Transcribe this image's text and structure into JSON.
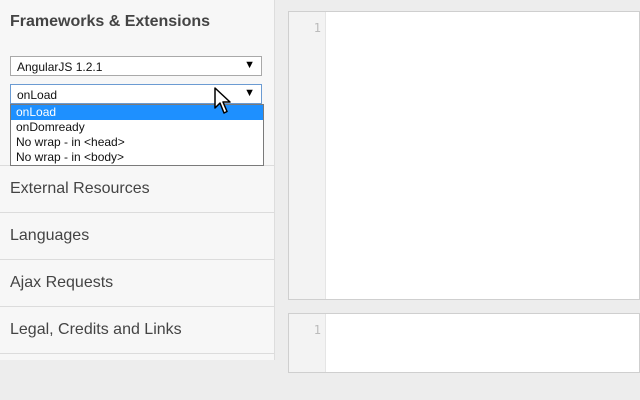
{
  "sidebar": {
    "title": "Frameworks & Extensions",
    "framework_select": {
      "value": "AngularJS 1.2.1"
    },
    "load_select": {
      "value": "onLoad",
      "options": [
        "onLoad",
        "onDomready",
        "No wrap - in <head>",
        "No wrap - in <body>"
      ],
      "selected_index": 0
    },
    "panels": [
      "",
      "External Resources",
      "Languages",
      "Ajax Requests",
      "Legal, Credits and Links"
    ]
  },
  "editors": [
    {
      "line_number": "1"
    },
    {
      "line_number": "1"
    }
  ],
  "colors": {
    "highlight": "#1e90ff"
  },
  "icons": {
    "dropdown_arrow": "triangle-down",
    "cursor": "mouse-pointer"
  }
}
